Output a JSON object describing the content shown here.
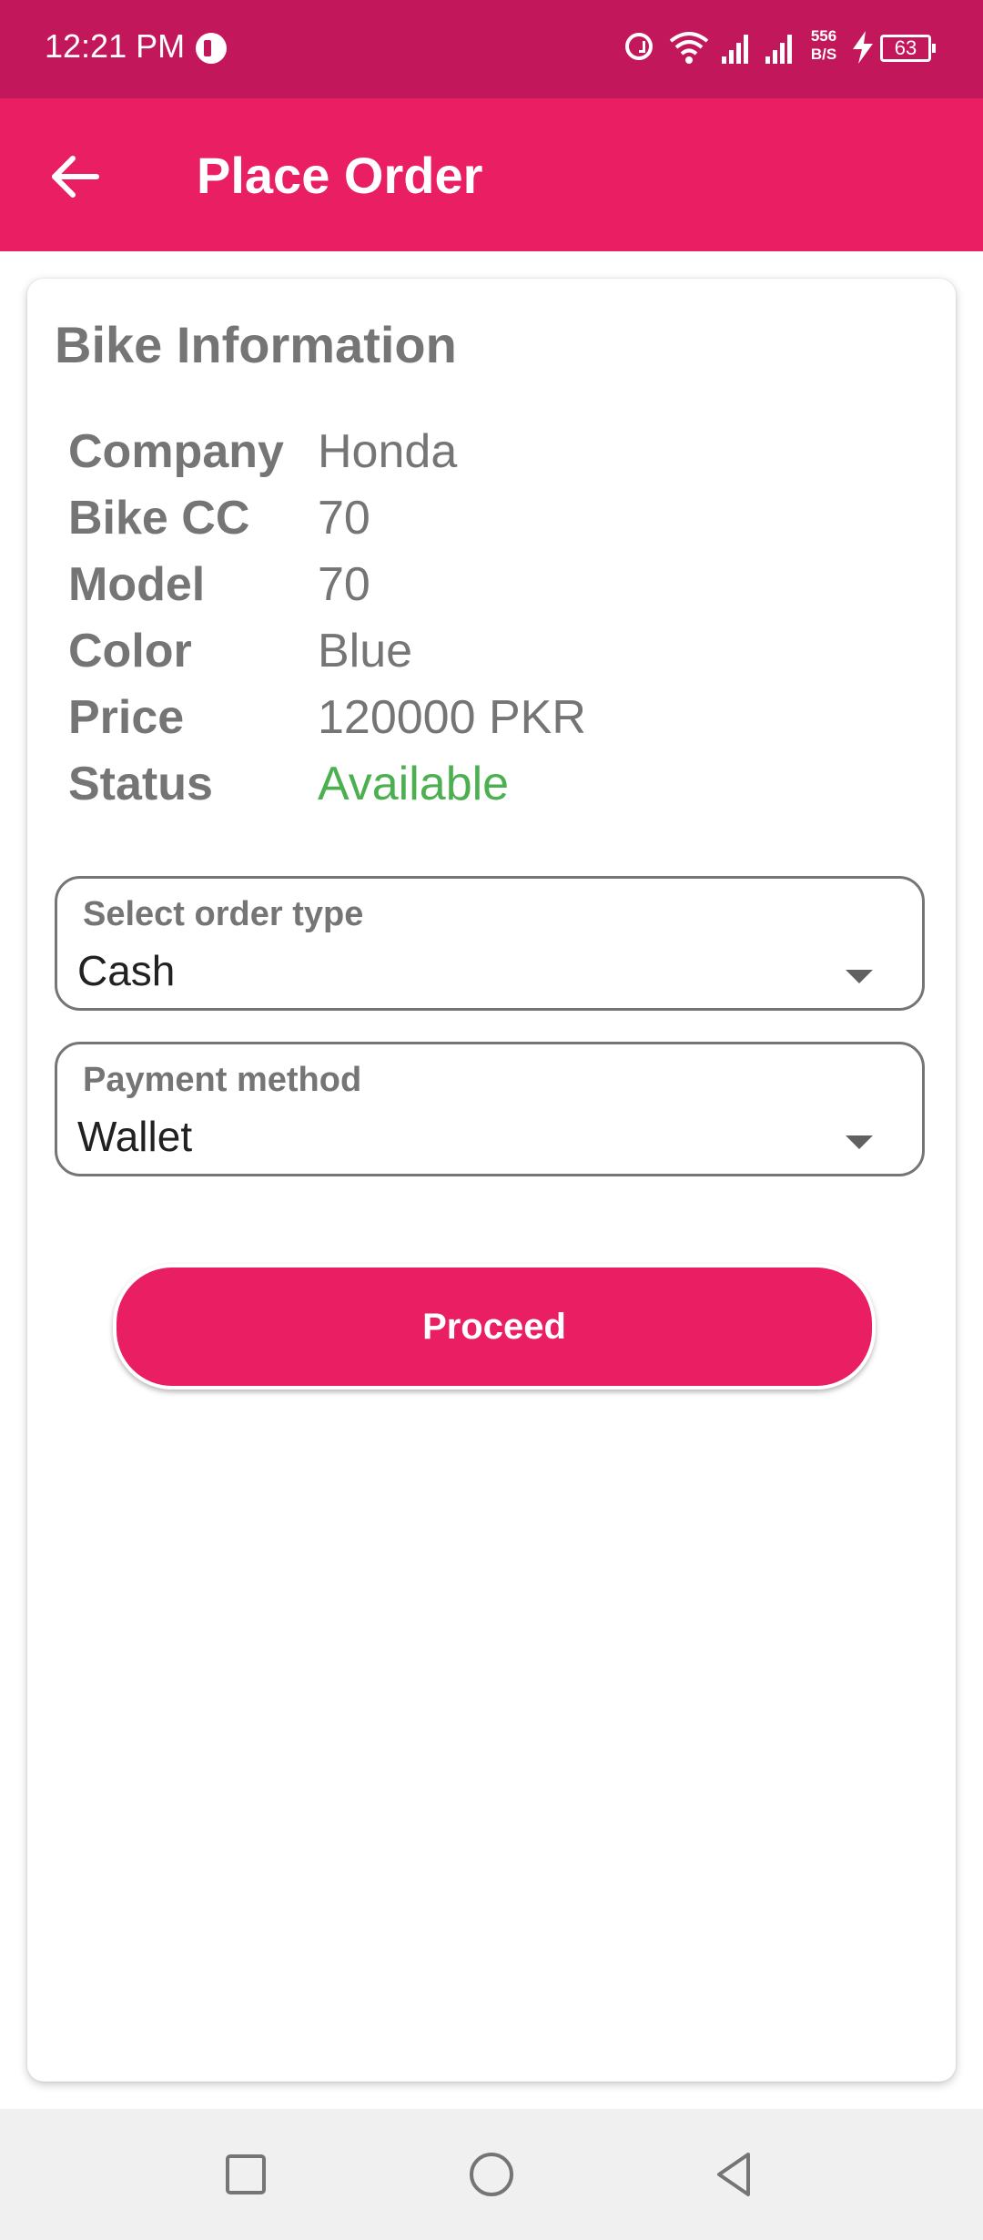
{
  "status_bar": {
    "time": "12:21 PM",
    "speed_line1": "556",
    "speed_line2": "B/S",
    "battery": "63",
    "icons": [
      "app-icon",
      "alarm-icon",
      "wifi-icon",
      "signal-icon",
      "signal-icon",
      "charging-icon",
      "battery-icon"
    ]
  },
  "app_bar": {
    "title": "Place Order",
    "back_icon": "arrow-left-icon"
  },
  "card": {
    "title": "Bike Information",
    "rows": [
      {
        "label": "Company",
        "value": "Honda"
      },
      {
        "label": "Bike CC",
        "value": "70"
      },
      {
        "label": "Model",
        "value": "70"
      },
      {
        "label": "Color",
        "value": "Blue"
      },
      {
        "label": "Price",
        "value": "120000 PKR"
      },
      {
        "label": "Status",
        "value": "Available"
      }
    ]
  },
  "order_type": {
    "label": "Select order type",
    "value": "Cash"
  },
  "payment_method": {
    "label": "Payment method",
    "value": "Wallet"
  },
  "proceed_label": "Proceed",
  "colors": {
    "status_bar": "#C2185B",
    "primary": "#E91E63",
    "label_gray": "#757575",
    "available_green": "#4CAF50"
  },
  "nav_bar": {
    "icons": [
      "recent-apps-icon",
      "home-icon",
      "back-icon"
    ]
  }
}
